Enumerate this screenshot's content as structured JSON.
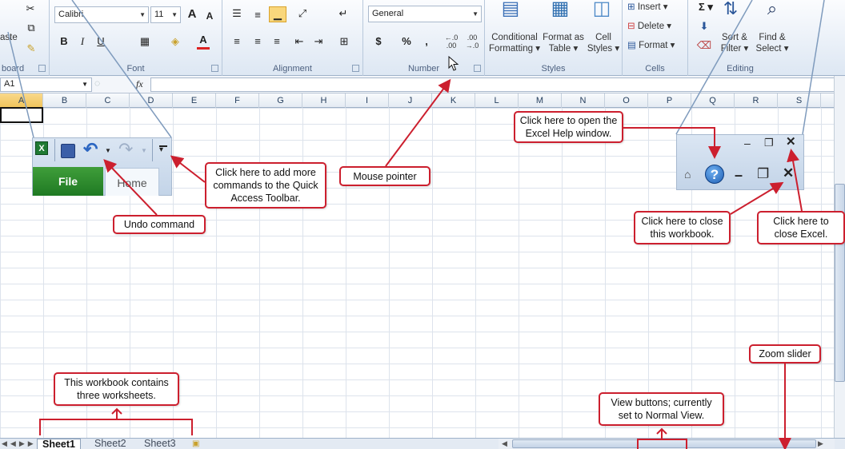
{
  "ribbon": {
    "clipboard": {
      "paste_fragment": "aste",
      "label": "board"
    },
    "font": {
      "name": "Calibri",
      "size": "11",
      "label": "Font",
      "grow": "A",
      "shrink": "A",
      "bold": "B",
      "italic": "I",
      "underline": "U",
      "color_letter": "A"
    },
    "alignment": {
      "label": "Alignment"
    },
    "number": {
      "format": "General",
      "label": "Number",
      "currency": "$",
      "percent": "%",
      "comma": ",",
      "inc_dec": "←.0 .00",
      "dec_dec": ".00 →.0"
    },
    "styles": {
      "label": "Styles",
      "conditional": "Conditional Formatting ▾",
      "format_table": "Format as Table ▾",
      "cell_styles": "Cell Styles ▾"
    },
    "cells": {
      "label": "Cells",
      "insert": "Insert ▾",
      "delete": "Delete ▾",
      "format": "Format ▾"
    },
    "editing": {
      "label": "Editing",
      "sort": "Sort & Filter ▾",
      "find": "Find & Select ▾",
      "sigma": "Σ ▾"
    }
  },
  "formula_bar": {
    "name_box": "A1",
    "fx": "fx",
    "value": ""
  },
  "columns": [
    "A",
    "B",
    "C",
    "D",
    "E",
    "F",
    "G",
    "H",
    "I",
    "J",
    "K",
    "L",
    "M",
    "N",
    "O",
    "P",
    "Q",
    "R",
    "S"
  ],
  "quick_access": {
    "file_tab": "File",
    "home_tab": "Home"
  },
  "sheets": [
    "Sheet1",
    "Sheet2",
    "Sheet3"
  ],
  "callouts": {
    "qat_more": "Click here to add more commands to the Quick Access Toolbar.",
    "undo": "Undo command",
    "mouse": "Mouse pointer",
    "help": "Click here to open the Excel Help window.",
    "close_workbook": "Click here to close this workbook.",
    "close_excel": "Click here to close Excel.",
    "three_sheets": "This workbook contains three worksheets.",
    "view_buttons": "View buttons; currently set to Normal View.",
    "zoom": "Zoom slider"
  },
  "colors": {
    "callout_border": "#cc1f2e",
    "file_tab": "#2a8a2d",
    "accent": "#2b579a"
  }
}
